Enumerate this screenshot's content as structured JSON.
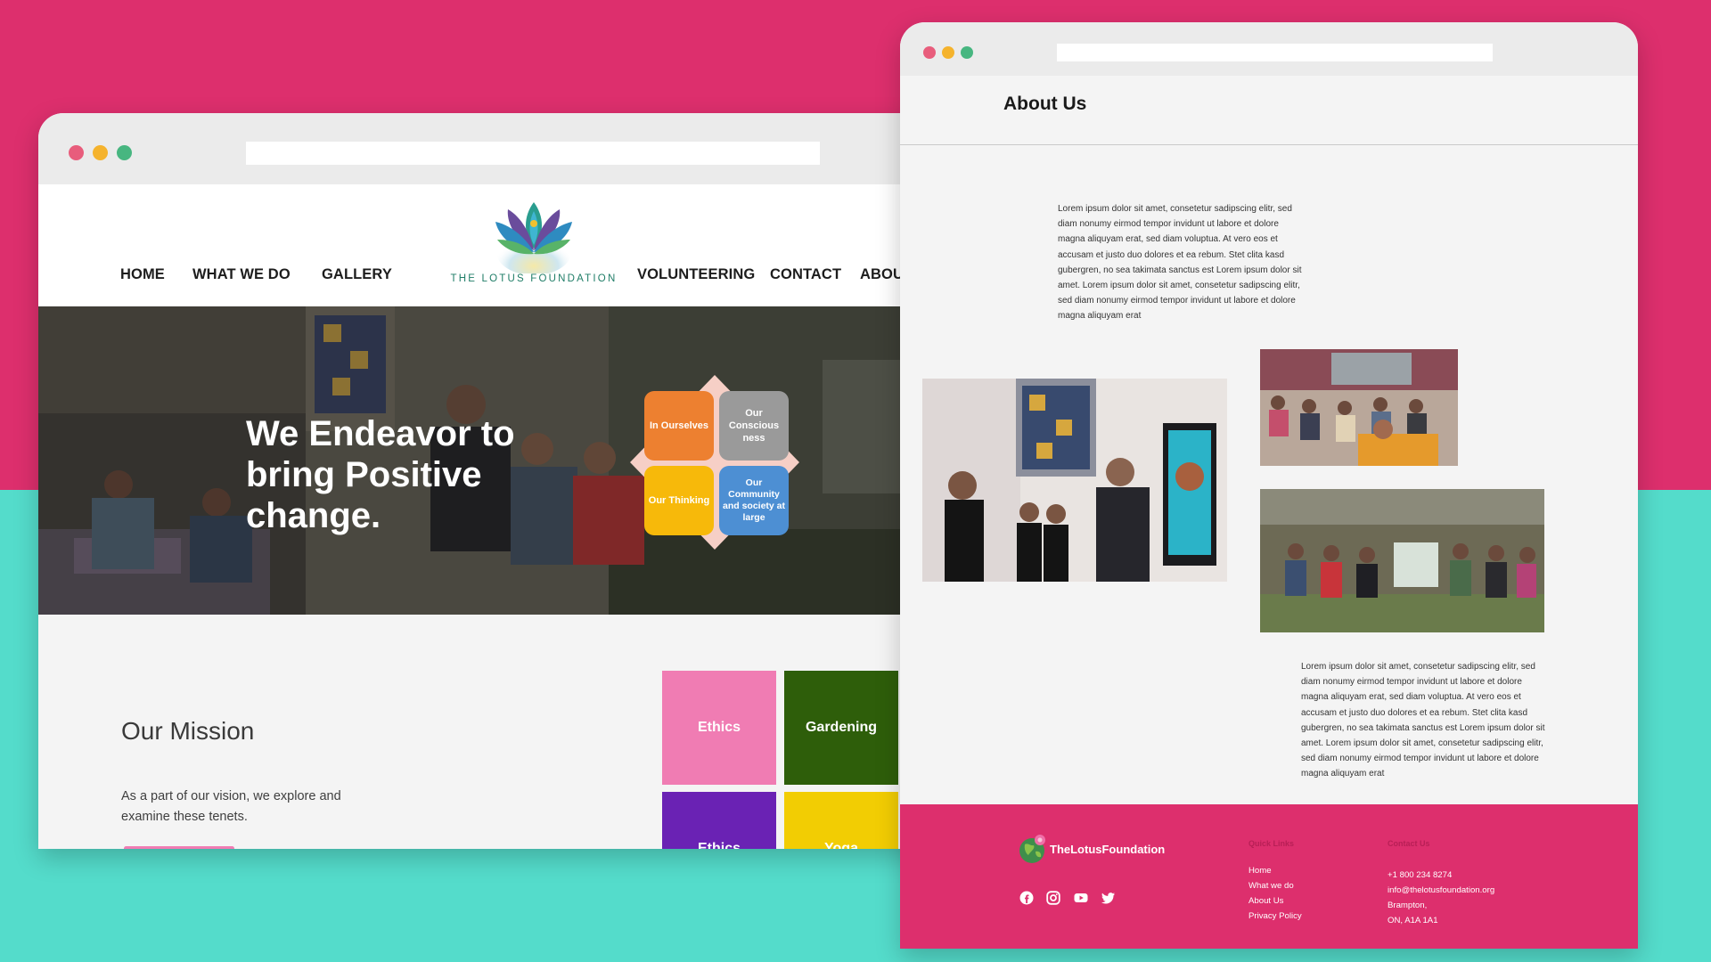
{
  "left_window": {
    "nav": {
      "home": "HOME",
      "what_we_do": "WHAT WE DO",
      "gallery": "GALLERY",
      "volunteering": "VOLUNTEERING",
      "contact": "CONTACT",
      "about": "ABOU"
    },
    "logo_text": "THE LOTUS FOUNDATION",
    "hero": {
      "title": "We Endeavor to bring Positive change.",
      "diamond": {
        "in_ourselves": "In Ourselves",
        "our_consciousness": "Our Conscious ness",
        "our_thinking": "Our Thinking",
        "our_community": "Our Community and society at large"
      }
    },
    "mission": {
      "title": "Our Mission",
      "text": "As a part of our vision, we explore and examine these tenets."
    },
    "tenets": {
      "ethics": "Ethics",
      "gardening": "Gardening",
      "ethics_2": "Ethics",
      "yoga": "Yoga"
    }
  },
  "right_window": {
    "page_title": "About Us",
    "paragraph_1": "Lorem ipsum dolor sit amet, consetetur sadipscing elitr, sed diam nonumy eirmod tempor invidunt ut labore et dolore magna aliquyam erat, sed diam voluptua. At vero eos et accusam et justo duo dolores et ea rebum. Stet clita kasd gubergren, no sea takimata sanctus est Lorem ipsum dolor sit amet. Lorem ipsum dolor sit amet, consetetur sadipscing elitr, sed diam nonumy eirmod tempor invidunt ut labore et dolore magna aliquyam erat",
    "paragraph_2": "Lorem ipsum dolor sit amet, consetetur sadipscing elitr, sed diam nonumy eirmod tempor invidunt ut labore et dolore magna aliquyam erat, sed diam voluptua. At vero eos et accusam et justo duo dolores et ea rebum. Stet clita kasd gubergren, no sea takimata sanctus est Lorem ipsum dolor sit amet. Lorem ipsum dolor sit amet, consetetur sadipscing elitr, sed diam nonumy eirmod tempor invidunt ut labore et dolore magna aliquyam erat",
    "footer": {
      "brand": "TheLotusFoundation",
      "quick_links_heading": "Quick Links",
      "contact_heading": "Contact Us",
      "quick_links": [
        "Home",
        "What we do",
        "About Us",
        "Privacy Policy"
      ],
      "phone": "+1 800 234 8274",
      "email": "info@thelotusfoundation.org",
      "city": "Brampton,",
      "postal": "ON, A1A 1A1",
      "social_icons": [
        "facebook-icon",
        "instagram-icon",
        "youtube-icon",
        "twitter-icon"
      ]
    }
  },
  "colors": {
    "backdrop_top": "#dd2f6d",
    "backdrop_bottom": "#54dccb",
    "footer": "#dd2f6d",
    "tile_orange": "#ed8030",
    "tile_grey": "#9a9a9a",
    "tile_yellow": "#f7b90a",
    "tile_blue": "#4d8fd3",
    "tenet_pink": "#f07cb3",
    "tenet_green": "#2e5e0a",
    "tenet_purple": "#6a22b4",
    "tenet_yellow": "#f2cd03"
  }
}
